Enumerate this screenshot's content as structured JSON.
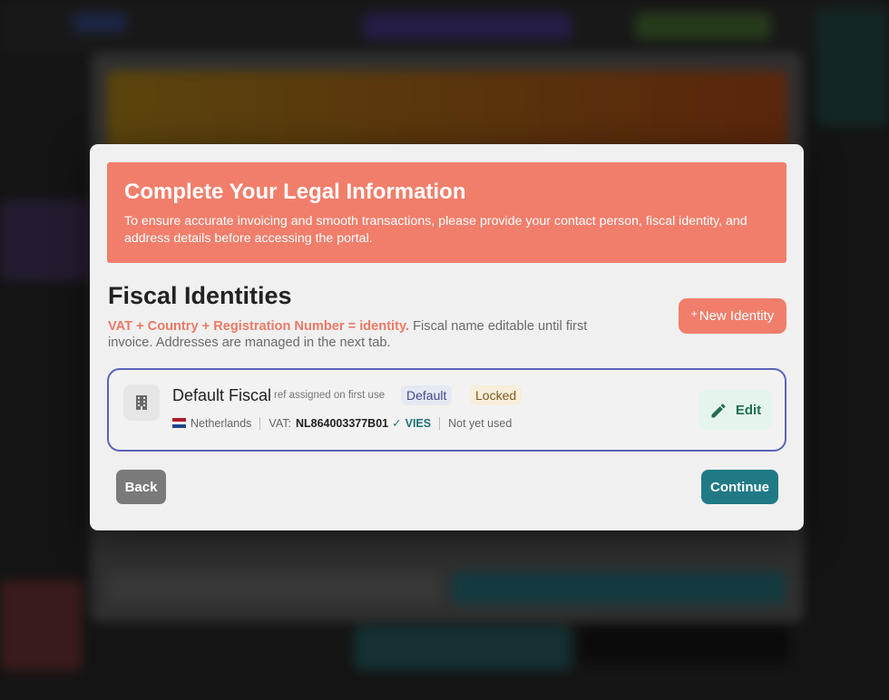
{
  "modal": {
    "close_label": "×",
    "banner": {
      "title": "Complete Your Legal Information",
      "text": "To ensure accurate invoicing and smooth transactions, please provide your contact person, fiscal identity, and address details before accessing the portal."
    },
    "section_title": "Fiscal Identities",
    "description": {
      "highlight": "VAT + Country + Registration Number = identity.",
      "rest": " Fiscal name editable until first invoice. Addresses are managed in the next tab."
    },
    "new_identity_button": {
      "plus": "+",
      "label": "New Identity"
    },
    "identity_card": {
      "name": "Default Fiscal",
      "ref_note": "ref assigned on first use",
      "badge_default": "Default",
      "badge_locked": "Locked",
      "country": "Netherlands",
      "vat_label": "VAT:",
      "vat_number": "NL864003377B01",
      "vies_check": "✓",
      "vies_label": "VIES",
      "usage_status": "Not yet used",
      "edit_label": "Edit",
      "icon": "building-icon"
    },
    "back_label": "Back",
    "continue_label": "Continue"
  },
  "colors": {
    "accent_coral": "#f07e6b",
    "primary_teal": "#1f7a86",
    "card_border": "#5a64b8",
    "edit_green": "#1f6e4f"
  }
}
